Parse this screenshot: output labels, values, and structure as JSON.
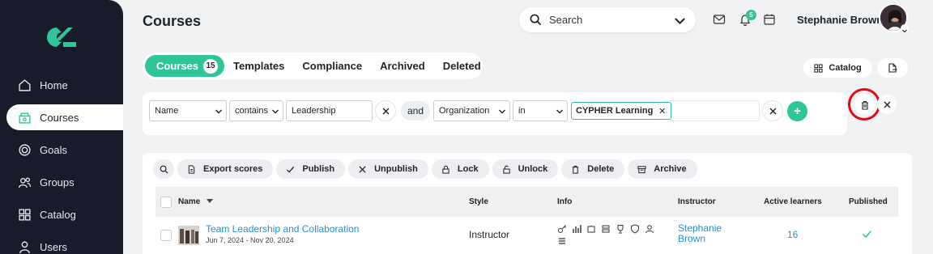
{
  "sidebar": {
    "items": [
      {
        "label": "Home",
        "icon": "home-icon"
      },
      {
        "label": "Courses",
        "icon": "courses-icon",
        "active": true
      },
      {
        "label": "Goals",
        "icon": "goals-icon"
      },
      {
        "label": "Groups",
        "icon": "groups-icon"
      },
      {
        "label": "Catalog",
        "icon": "catalog-icon"
      },
      {
        "label": "Users",
        "icon": "users-icon"
      }
    ]
  },
  "header": {
    "title": "Courses",
    "search_placeholder": "Search",
    "notification_count": "5",
    "user_name": "Stephanie Brown"
  },
  "tabs": {
    "items": [
      {
        "label": "Courses",
        "count": "15"
      },
      {
        "label": "Templates"
      },
      {
        "label": "Compliance"
      },
      {
        "label": "Archived"
      },
      {
        "label": "Deleted"
      }
    ],
    "catalog_label": "Catalog"
  },
  "filter": {
    "rule1": {
      "field": "Name",
      "operator": "contains",
      "value": "Leadership"
    },
    "joiner": "and",
    "rule2": {
      "field": "Organization",
      "operator": "in",
      "chip": "CYPHER Learning"
    },
    "add_label": "+"
  },
  "actions": [
    "Export scores",
    "Publish",
    "Unpublish",
    "Lock",
    "Unlock",
    "Delete",
    "Archive"
  ],
  "table": {
    "columns": [
      "Name",
      "Style",
      "Info",
      "Instructor",
      "Active learners",
      "Published"
    ],
    "rows": [
      {
        "name": "Team Leadership and Collaboration",
        "dates": "Jun 7, 2024 - Nov 20, 2024",
        "style": "Instructor",
        "instructor_line1": "Stephanie",
        "instructor_line2": "Brown",
        "active_learners": "16",
        "published": true
      }
    ]
  },
  "colors": {
    "accent": "#2fc598",
    "sidebar_bg": "#181b2a",
    "link": "#2b8fcf",
    "highlight_ring": "#e10a14"
  }
}
